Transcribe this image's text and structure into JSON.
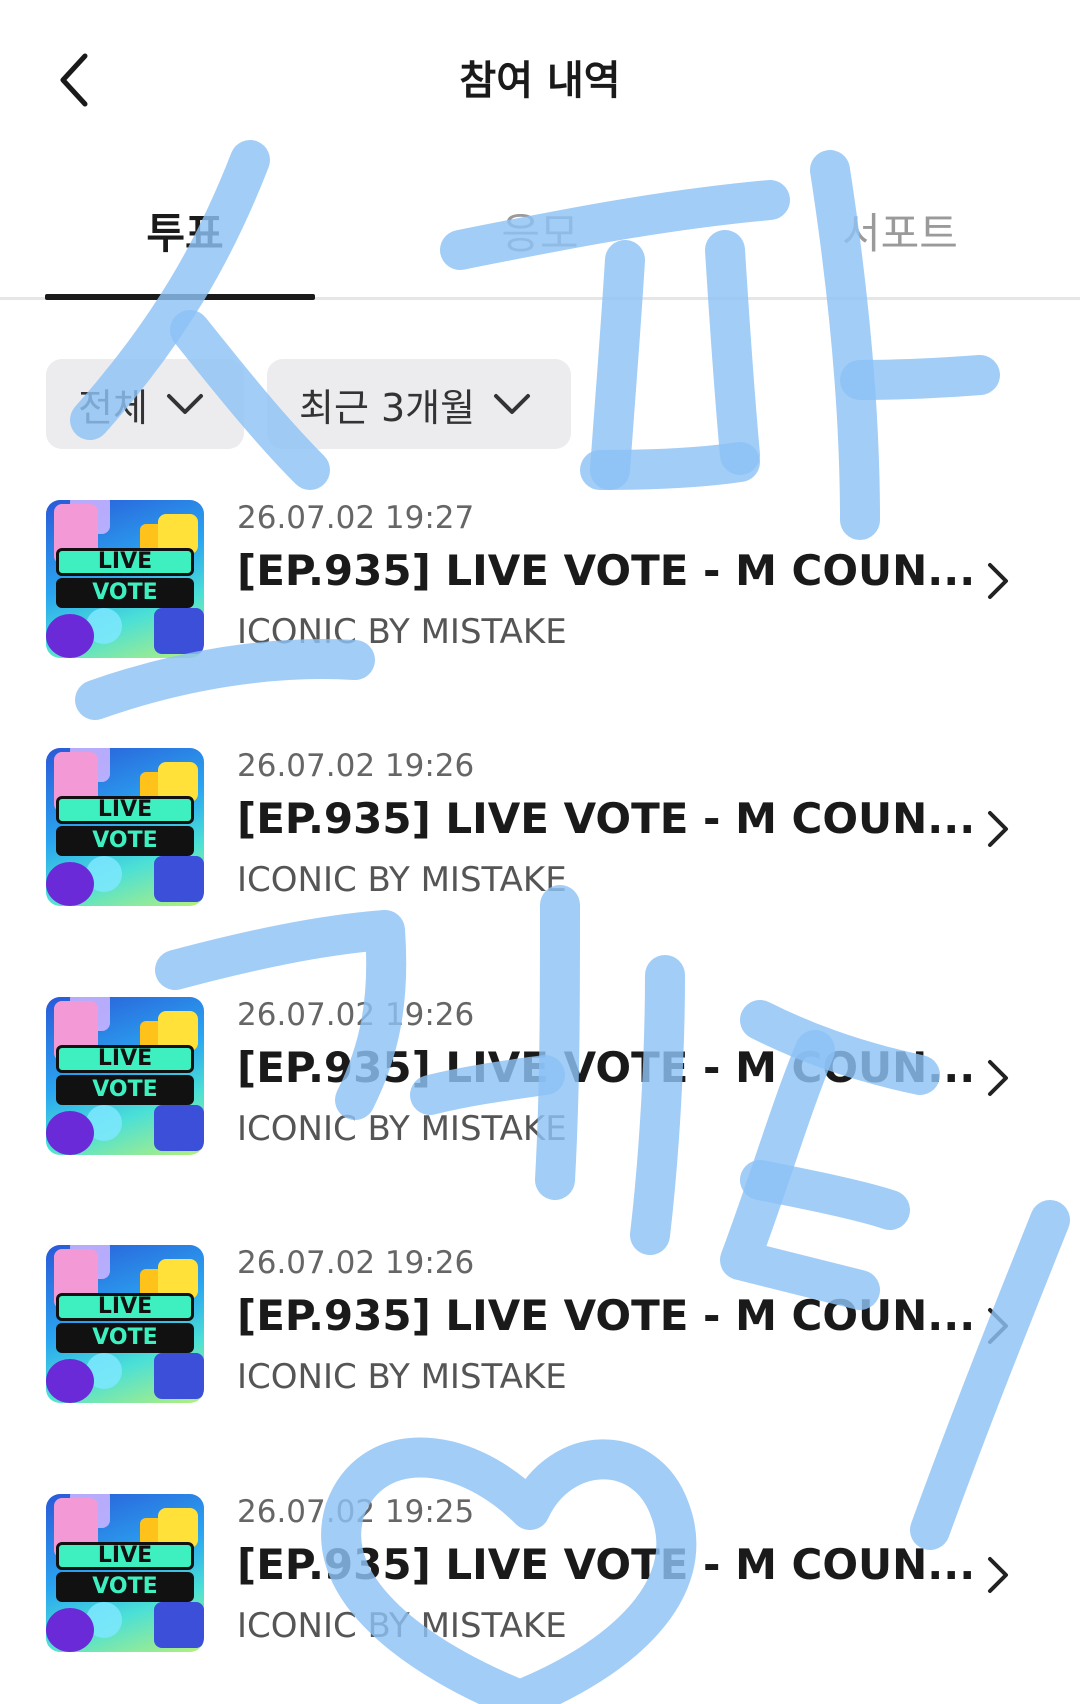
{
  "header": {
    "title": "참여 내역"
  },
  "tabs": [
    {
      "label": "투표",
      "active": true
    },
    {
      "label": "응모",
      "active": false
    },
    {
      "label": "서포트",
      "active": false
    }
  ],
  "filters": {
    "category": "전체",
    "period": "최근 3개월"
  },
  "thumbnail_text": {
    "line1": "LIVE",
    "line2": "VOTE"
  },
  "items": [
    {
      "date": "26.07.02 19:27",
      "title": "[EP.935] LIVE VOTE - M COUN...",
      "artist": "ICONIC BY MISTAKE"
    },
    {
      "date": "26.07.02 19:26",
      "title": "[EP.935] LIVE VOTE - M COUN...",
      "artist": "ICONIC BY MISTAKE"
    },
    {
      "date": "26.07.02 19:26",
      "title": "[EP.935] LIVE VOTE - M COUN...",
      "artist": "ICONIC BY MISTAKE"
    },
    {
      "date": "26.07.02 19:26",
      "title": "[EP.935] LIVE VOTE - M COUN...",
      "artist": "ICONIC BY MISTAKE"
    },
    {
      "date": "26.07.02 19:25",
      "title": "[EP.935] LIVE VOTE - M COUN...",
      "artist": "ICONIC BY MISTAKE"
    }
  ],
  "icons": {
    "back": "chevron-left-icon",
    "dropdown": "chevron-down-icon",
    "row_arrow": "chevron-right-icon"
  },
  "colors": {
    "text_primary": "#1a1a1a",
    "text_inactive": "#9a9a9a",
    "filter_bg": "#ececef",
    "doodle": "#8cc2f5"
  }
}
